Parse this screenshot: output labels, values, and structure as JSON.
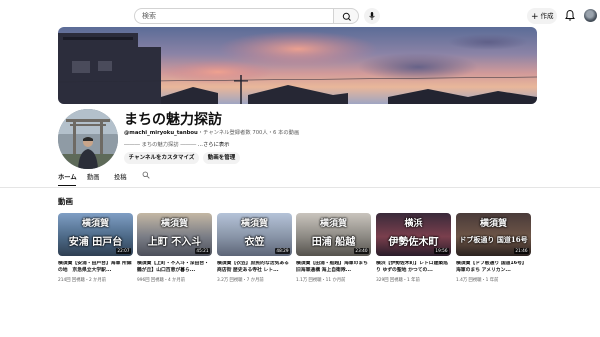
{
  "header": {
    "search_placeholder": "検索",
    "create_label": "作成"
  },
  "channel": {
    "name": "まちの魅力探訪",
    "handle": "@machi_miryoku_tanbou",
    "meta": "・チャンネル登録者数 700人・6 本の動画",
    "description": "――― まちの魅力探訪 ―――",
    "more": "...さらに表示",
    "customize_label": "チャンネルをカスタマイズ",
    "manage_label": "動画を管理"
  },
  "tabs": [
    "ホーム",
    "動画",
    "投稿"
  ],
  "section_title": "動画",
  "videos": [
    {
      "thumb_line1": "横須賀",
      "thumb_line2": "安浦  田戸台",
      "duration": "22:07",
      "title": "横須賀【安浦・田戸台】海軍 所縁の地　京急県立大学駅...",
      "meta": "214回 回視聴・2 か月前",
      "colors": [
        "#7f9ec4",
        "#4d6a88",
        "#2f3f52"
      ]
    },
    {
      "thumb_line1": "横須賀",
      "thumb_line2": "上町  不入斗",
      "duration": "45:21",
      "title": "横須賀【上町・不入斗・深田台・鶴が丘】山口百恵が暮ら...",
      "meta": "996回 回視聴・4 か月前",
      "colors": [
        "#c4b7a4",
        "#7a7d86",
        "#4c4f5a"
      ]
    },
    {
      "thumb_line1": "横須賀",
      "thumb_line2": "衣笠",
      "duration": "48:29",
      "title": "横須賀【衣笠】庶民的な活気ある商店街 歴史ある寺社 レト...",
      "meta": "3.2万 回視聴・7 か月前",
      "colors": [
        "#b5c3d8",
        "#8995a8",
        "#5d6577"
      ]
    },
    {
      "thumb_line1": "横須賀",
      "thumb_line2": "田浦  船越",
      "duration": "23:40",
      "title": "横須賀【田浦・船越】海軍のまち 旧海軍通構 海上自衛隊...",
      "meta": "1.1万 回視聴・11 か月前",
      "colors": [
        "#c9c4bd",
        "#8d8a84",
        "#55524d"
      ]
    },
    {
      "thumb_line1": "横浜",
      "thumb_line2": "伊勢佐木町",
      "duration": "19:56",
      "title": "横浜【伊勢佐木町】レトロ建築巡り ゆずの聖地 かつての...",
      "meta": "329回 回視聴・1 年前",
      "colors": [
        "#3a2a3a",
        "#7a3f4d",
        "#2a1d2a"
      ]
    },
    {
      "thumb_line1": "横須賀",
      "thumb_line2": "ドブ板通り 国道16号",
      "duration": "21:46",
      "title": "横須賀【ドブ板通り 国道16号】海軍のまち アメリカン...",
      "meta": "1.4万 回視聴・1 年前",
      "colors": [
        "#4a3b3a",
        "#6d5547",
        "#2b2220"
      ]
    }
  ]
}
